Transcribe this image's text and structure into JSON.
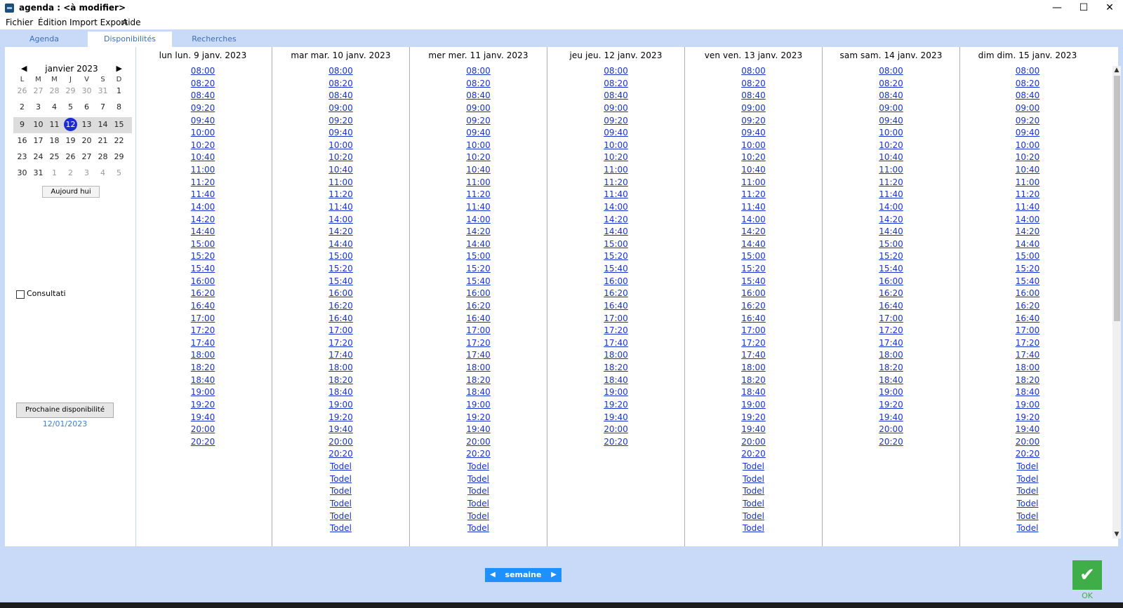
{
  "window": {
    "title": "agenda : <à modifier>",
    "min": "—",
    "max": "☐",
    "close": "✕"
  },
  "menu": {
    "fichier": "Fichier",
    "edition": "Édition",
    "import_export": "Import Export",
    "aide": "Aide"
  },
  "tabs": {
    "agenda": "Agenda",
    "disponibilites": "Disponibilités",
    "recherches": "Recherches"
  },
  "calendar": {
    "prev": "◀",
    "next": "▶",
    "title": "janvier 2023",
    "dow": [
      "L",
      "M",
      "M",
      "J",
      "V",
      "S",
      "D"
    ],
    "weeks": [
      [
        "26",
        "27",
        "28",
        "29",
        "30",
        "31",
        "1"
      ],
      [
        "2",
        "3",
        "4",
        "5",
        "6",
        "7",
        "8"
      ],
      [
        "9",
        "10",
        "11",
        "12",
        "13",
        "14",
        "15"
      ],
      [
        "16",
        "17",
        "18",
        "19",
        "20",
        "21",
        "22"
      ],
      [
        "23",
        "24",
        "25",
        "26",
        "27",
        "28",
        "29"
      ],
      [
        "30",
        "31",
        "1",
        "2",
        "3",
        "4",
        "5"
      ]
    ],
    "today_button": "Aujourd hui"
  },
  "left": {
    "consult_label": "Consultati",
    "next_avail_button": "Prochaine disponibilité",
    "next_avail_date": "12/01/2023"
  },
  "days": [
    {
      "header": "lun lun. 9 janv. 2023",
      "slots": [
        "08:00",
        "08:20",
        "08:40",
        "09:20",
        "09:40",
        "10:00",
        "10:20",
        "10:40",
        "11:00",
        "11:20",
        "11:40",
        "14:00",
        "14:20",
        "14:40",
        "15:00",
        "15:20",
        "15:40",
        "16:00",
        "16:20",
        "16:40",
        "17:00",
        "17:20",
        "17:40",
        "18:00",
        "18:20",
        "18:40",
        "19:00",
        "19:20",
        "19:40",
        "20:00",
        "20:20"
      ]
    },
    {
      "header": "mar mar. 10 janv. 2023",
      "slots": [
        "08:00",
        "08:20",
        "08:40",
        "09:00",
        "09:20",
        "09:40",
        "10:00",
        "10:20",
        "10:40",
        "11:00",
        "11:20",
        "11:40",
        "14:00",
        "14:20",
        "14:40",
        "15:00",
        "15:20",
        "15:40",
        "16:00",
        "16:20",
        "16:40",
        "17:00",
        "17:20",
        "17:40",
        "18:00",
        "18:20",
        "18:40",
        "19:00",
        "19:20",
        "19:40",
        "20:00",
        "20:20",
        "Todel",
        "Todel",
        "Todel",
        "Todel",
        "Todel",
        "Todel"
      ]
    },
    {
      "header": "mer mer. 11 janv. 2023",
      "slots": [
        "08:00",
        "08:20",
        "08:40",
        "09:00",
        "09:20",
        "09:40",
        "10:00",
        "10:20",
        "10:40",
        "11:00",
        "11:20",
        "11:40",
        "14:00",
        "14:20",
        "14:40",
        "15:00",
        "15:20",
        "15:40",
        "16:00",
        "16:20",
        "16:40",
        "17:00",
        "17:20",
        "17:40",
        "18:00",
        "18:20",
        "18:40",
        "19:00",
        "19:20",
        "19:40",
        "20:00",
        "20:20",
        "Todel",
        "Todel",
        "Todel",
        "Todel",
        "Todel",
        "Todel"
      ]
    },
    {
      "header": "jeu jeu. 12 janv. 2023",
      "slots": [
        "08:00",
        "08:20",
        "08:40",
        "09:00",
        "09:20",
        "09:40",
        "10:00",
        "10:20",
        "11:00",
        "11:20",
        "11:40",
        "14:00",
        "14:20",
        "14:40",
        "15:00",
        "15:20",
        "15:40",
        "16:00",
        "16:20",
        "16:40",
        "17:00",
        "17:20",
        "17:40",
        "18:00",
        "18:20",
        "18:40",
        "19:00",
        "19:20",
        "19:40",
        "20:00",
        "20:20"
      ]
    },
    {
      "header": "ven ven. 13 janv. 2023",
      "slots": [
        "08:00",
        "08:20",
        "08:40",
        "09:00",
        "09:20",
        "09:40",
        "10:00",
        "10:20",
        "10:40",
        "11:00",
        "11:20",
        "11:40",
        "14:00",
        "14:20",
        "14:40",
        "15:00",
        "15:20",
        "15:40",
        "16:00",
        "16:20",
        "16:40",
        "17:00",
        "17:20",
        "17:40",
        "18:00",
        "18:20",
        "18:40",
        "19:00",
        "19:20",
        "19:40",
        "20:00",
        "20:20",
        "Todel",
        "Todel",
        "Todel",
        "Todel",
        "Todel",
        "Todel"
      ]
    },
    {
      "header": "sam sam. 14 janv. 2023",
      "slots": [
        "08:00",
        "08:20",
        "08:40",
        "09:00",
        "09:40",
        "10:00",
        "10:20",
        "10:40",
        "11:00",
        "11:20",
        "11:40",
        "14:00",
        "14:20",
        "14:40",
        "15:00",
        "15:20",
        "15:40",
        "16:00",
        "16:20",
        "16:40",
        "17:00",
        "17:20",
        "17:40",
        "18:00",
        "18:20",
        "18:40",
        "19:00",
        "19:20",
        "19:40",
        "20:00",
        "20:20"
      ]
    },
    {
      "header": "dim dim. 15 janv. 2023",
      "slots": [
        "08:00",
        "08:20",
        "08:40",
        "09:00",
        "09:20",
        "09:40",
        "10:00",
        "10:20",
        "10:40",
        "11:00",
        "11:20",
        "11:40",
        "14:00",
        "14:20",
        "14:40",
        "15:00",
        "15:20",
        "15:40",
        "16:00",
        "16:20",
        "16:40",
        "17:00",
        "17:20",
        "17:40",
        "18:00",
        "18:20",
        "18:40",
        "19:00",
        "19:20",
        "19:40",
        "20:00",
        "20:20",
        "Todel",
        "Todel",
        "Todel",
        "Todel",
        "Todel",
        "Todel"
      ]
    }
  ],
  "scroll": {
    "up": "▲",
    "down": "▼"
  },
  "footer": {
    "week_prev": "◀",
    "week_label": "semaine",
    "week_next": "▶",
    "ok_icon": "✔",
    "ok_label": "OK"
  },
  "colors": {
    "link": "#1a33c8",
    "background": "#c9daf8",
    "ok_green": "#3fae49",
    "nav_blue": "#1e90ff",
    "selected_day": "#1c2bd6"
  }
}
